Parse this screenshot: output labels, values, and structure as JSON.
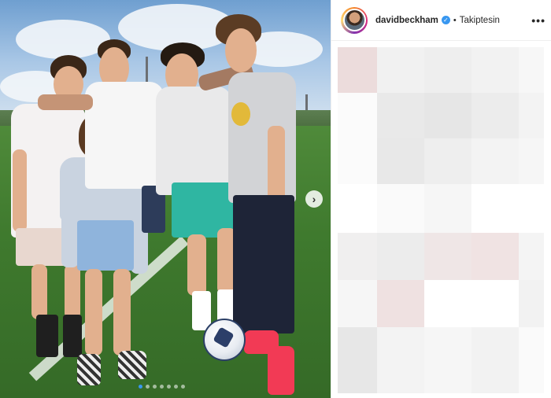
{
  "post": {
    "username": "davidbeckham",
    "separator": "•",
    "follow_status": "Takiptesin",
    "more_label": "•••",
    "next_arrow": "›",
    "carousel": {
      "count": 7,
      "active_index": 0
    }
  },
  "icons": {
    "verified": "verified-badge-icon",
    "more": "more-options-icon",
    "next": "chevron-right-icon"
  },
  "colors": {
    "accent": "#3897f0",
    "text": "#262626"
  }
}
